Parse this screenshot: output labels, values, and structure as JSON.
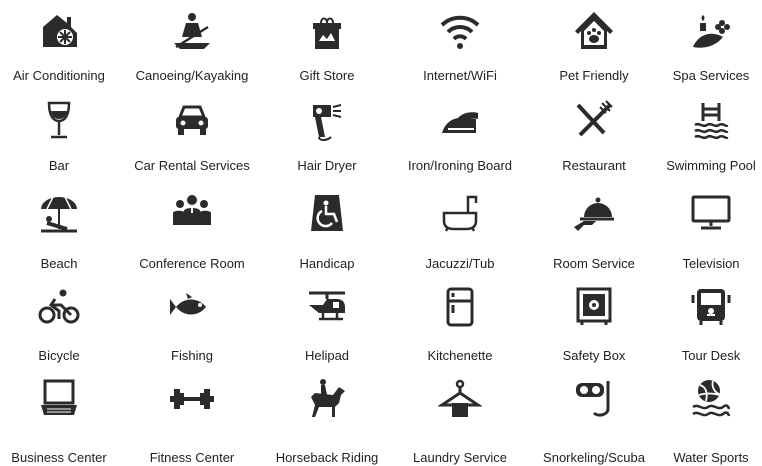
{
  "ink": "#2b2b2b",
  "amenities": [
    {
      "label": "Air Conditioning",
      "icon": "air-conditioning-icon"
    },
    {
      "label": "Canoeing/Kayaking",
      "icon": "canoeing-kayaking-icon"
    },
    {
      "label": "Gift Store",
      "icon": "gift-store-icon"
    },
    {
      "label": "Internet/WiFi",
      "icon": "wifi-icon"
    },
    {
      "label": "Pet Friendly",
      "icon": "pet-friendly-icon"
    },
    {
      "label": "Spa Services",
      "icon": "spa-services-icon"
    },
    {
      "label": "Bar",
      "icon": "bar-icon"
    },
    {
      "label": "Car Rental Services",
      "icon": "car-rental-icon"
    },
    {
      "label": "Hair Dryer",
      "icon": "hair-dryer-icon"
    },
    {
      "label": "Iron/Ironing Board",
      "icon": "iron-icon"
    },
    {
      "label": "Restaurant",
      "icon": "restaurant-icon"
    },
    {
      "label": "Swimming Pool",
      "icon": "swimming-pool-icon"
    },
    {
      "label": "Beach",
      "icon": "beach-icon"
    },
    {
      "label": "Conference Room",
      "icon": "conference-room-icon"
    },
    {
      "label": "Handicap",
      "icon": "handicap-icon"
    },
    {
      "label": "Jacuzzi/Tub",
      "icon": "jacuzzi-tub-icon"
    },
    {
      "label": "Room Service",
      "icon": "room-service-icon"
    },
    {
      "label": "Television",
      "icon": "television-icon"
    },
    {
      "label": "Bicycle",
      "icon": "bicycle-icon"
    },
    {
      "label": "Fishing",
      "icon": "fishing-icon"
    },
    {
      "label": "Helipad",
      "icon": "helipad-icon"
    },
    {
      "label": "Kitchenette",
      "icon": "kitchenette-icon"
    },
    {
      "label": "Safety Box",
      "icon": "safety-box-icon"
    },
    {
      "label": "Tour Desk",
      "icon": "tour-desk-icon"
    },
    {
      "label": "Business Center",
      "icon": "business-center-icon"
    },
    {
      "label": "Fitness Center",
      "icon": "fitness-center-icon"
    },
    {
      "label": "Horseback Riding",
      "icon": "horseback-riding-icon"
    },
    {
      "label": "Laundry Service",
      "icon": "laundry-service-icon"
    },
    {
      "label": "Snorkeling/Scuba",
      "icon": "snorkeling-scuba-icon"
    },
    {
      "label": "Water Sports",
      "icon": "water-sports-icon"
    }
  ]
}
